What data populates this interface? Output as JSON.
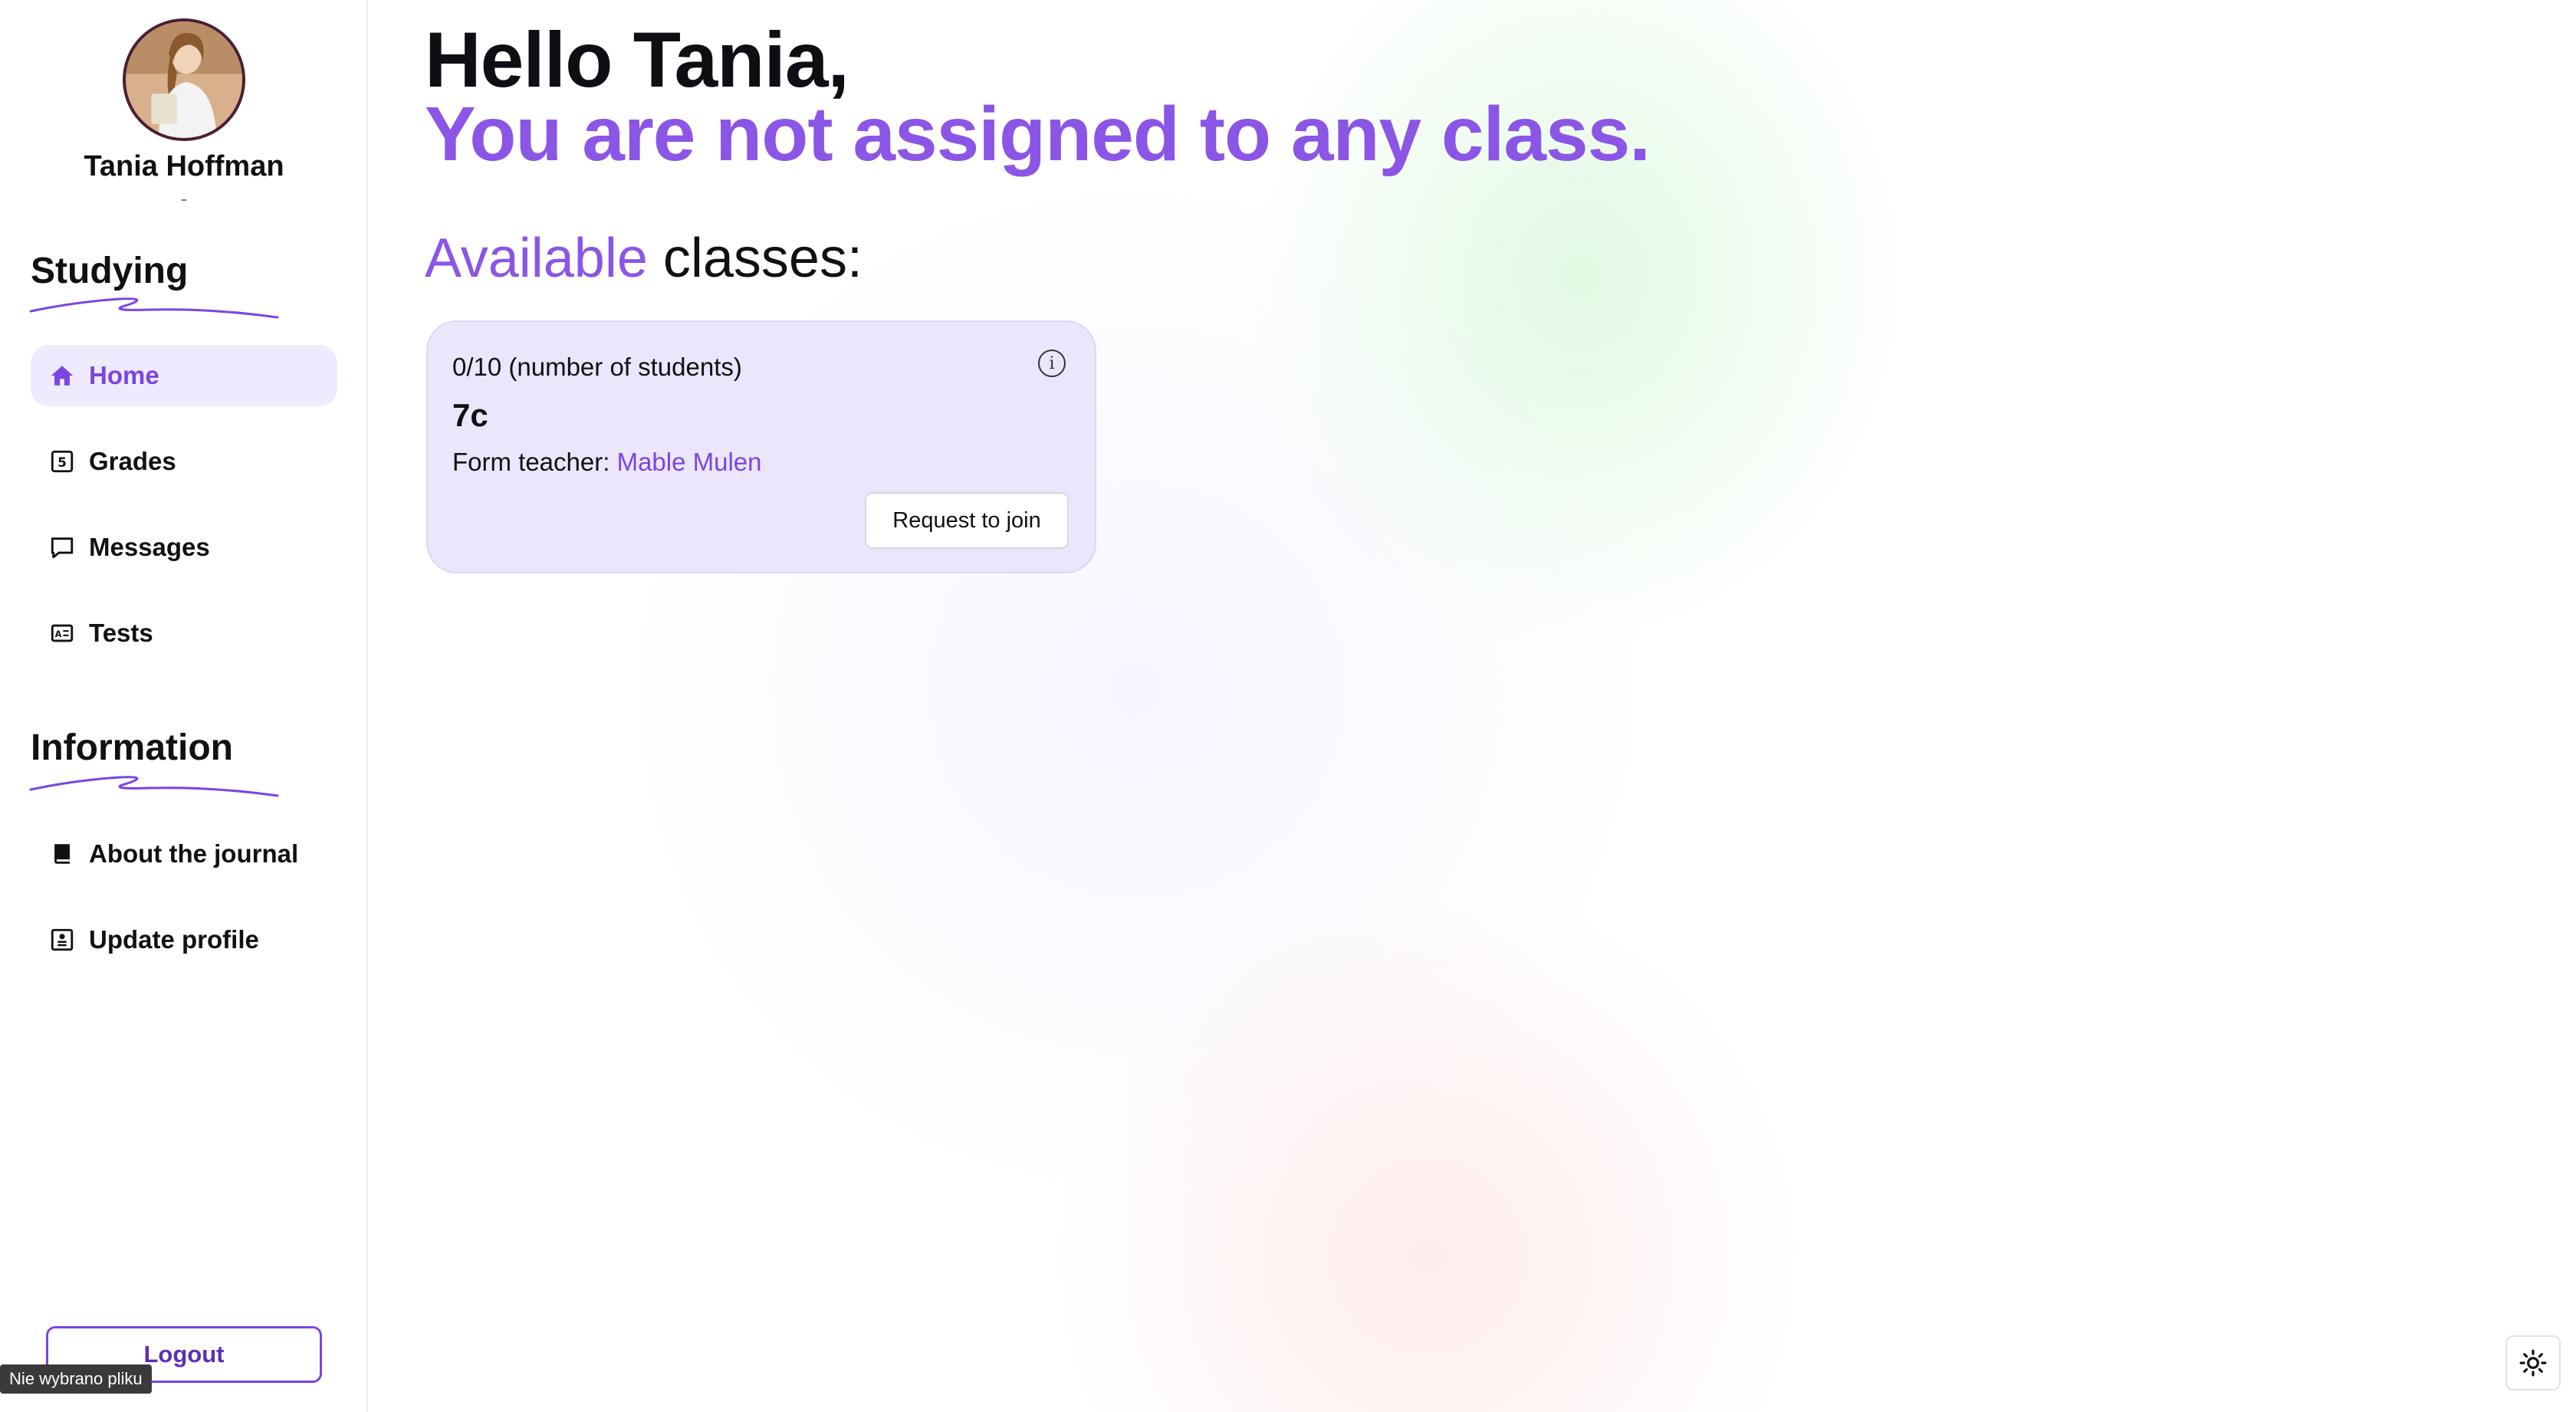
{
  "user": {
    "name": "Tania Hoffman",
    "subtitle": "-"
  },
  "sidebar": {
    "studying_title": "Studying",
    "studying_items": [
      {
        "label": "Home",
        "icon": "home-icon",
        "active": true
      },
      {
        "label": "Grades",
        "icon": "grades-icon",
        "active": false
      },
      {
        "label": "Messages",
        "icon": "message-icon",
        "active": false
      },
      {
        "label": "Tests",
        "icon": "test-icon",
        "active": false
      }
    ],
    "information_title": "Information",
    "information_items": [
      {
        "label": "About the journal",
        "icon": "book-icon"
      },
      {
        "label": "Update profile",
        "icon": "profile-icon"
      }
    ],
    "logout_label": "Logout",
    "file_tooltip": "Nie wybrano pliku"
  },
  "main": {
    "greeting": "Hello Tania,",
    "status": "You are not assigned to any class.",
    "available_accent": "Available",
    "available_rest": " classes:",
    "classes": [
      {
        "count": "0/10 (number of students)",
        "name": "7c",
        "teacher_label": "Form teacher: ",
        "teacher_name": "Mable Mulen",
        "join_label": "Request to join"
      }
    ]
  },
  "colors": {
    "accent": "#8b55e6",
    "accent_dark": "#7b45e0",
    "active_bg": "#efeaff",
    "card_bg": "#ebe6fb"
  }
}
